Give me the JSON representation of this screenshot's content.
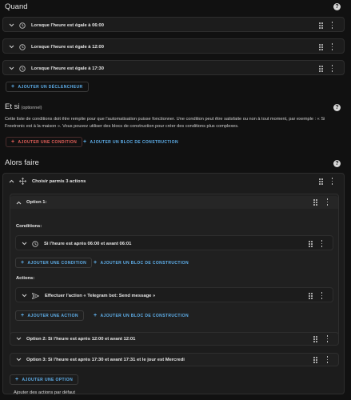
{
  "when": {
    "title": "Quand",
    "triggers": [
      {
        "label": "Lorsque l'heure est égale à 06:00"
      },
      {
        "label": "Lorsque l'heure est égale à 12:00"
      },
      {
        "label": "Lorsque l'heure est égale à 17:30"
      }
    ],
    "add_trigger": "AJOUTER UN DÉCLENCHEUR"
  },
  "and_if": {
    "title": "Et si",
    "optional": "(optionnel)",
    "description_line1": "Cette liste de conditions doit être remplie pour que l'automatisation puisse fonctionner. Une condition peut être satisfaite ou non à tout moment, par exemple : « Si",
    "description_line2": "Freetronic est à la maison ». Vous pouvez utiliser des blocs de construction pour créer des conditions plus complexes.",
    "add_condition": "AJOUTER UNE CONDITION",
    "add_block": "AJOUTER UN BLOC DE CONSTRUCTION"
  },
  "then": {
    "title": "Alors faire",
    "choose_label": "Choisir parmis 3 actions",
    "option1": {
      "label": "Option 1:",
      "conditions_title": "Conditions:",
      "condition_label": "Si l'heure est après 06:00 et avant 06:01",
      "add_condition": "AJOUTER UNE CONDITION",
      "add_block": "AJOUTER UN BLOC DE CONSTRUCTION",
      "actions_title": "Actions:",
      "action_label": "Effectuer l'action « Telegram bot: Send message »",
      "add_action": "AJOUTER UNE ACTION",
      "add_action_block": "AJOUTER UN BLOC DE CONSTRUCTION"
    },
    "option2": {
      "label": "Option 2: Si l'heure est après 12:00 et avant 12:01"
    },
    "option3": {
      "label": "Option 3: Si l'heure est après 17:30 et avant 17:31 et le jour est Mercredi"
    },
    "add_option": "AJOUTER UNE OPTION",
    "default_actions": "Ajouter des actions par défaut"
  },
  "colors": {
    "accent": "#5fb0ec",
    "danger": "#e8605a",
    "background": "#111111",
    "card": "#1c1c1c"
  },
  "icons": [
    "chevron-down-icon",
    "clock-icon",
    "drag-handle-icon",
    "more-vert-icon",
    "help-icon",
    "plus-icon",
    "arrows-move-icon",
    "send-icon"
  ]
}
